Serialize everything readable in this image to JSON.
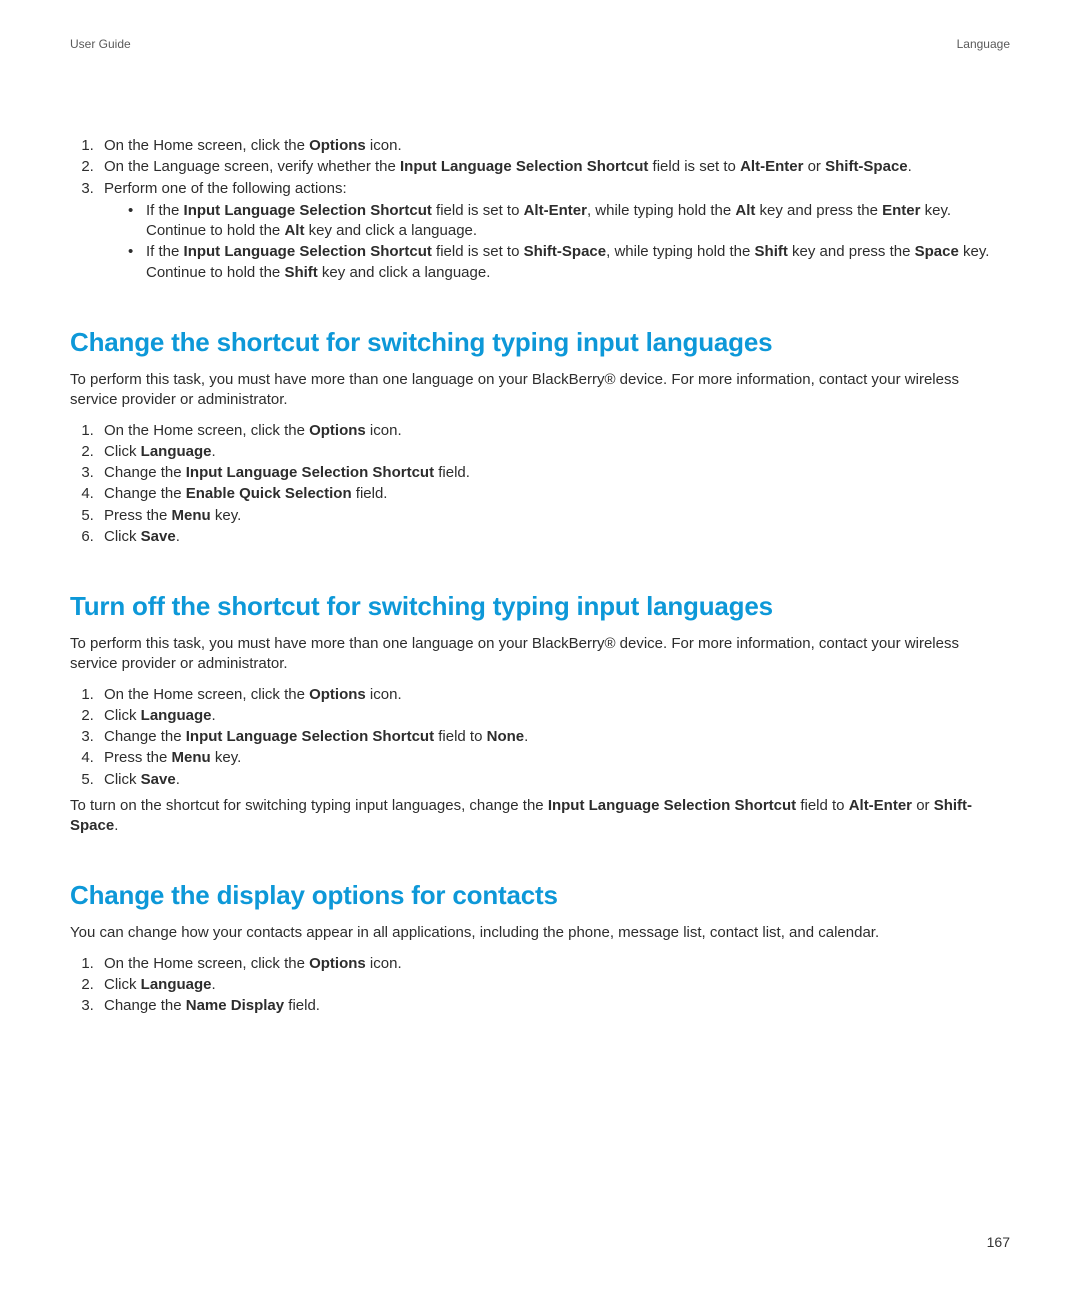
{
  "header": {
    "left": "User Guide",
    "right": "Language"
  },
  "intro": {
    "step1": {
      "t1": "On the Home screen, click the ",
      "b1": "Options",
      "t2": " icon."
    },
    "step2": {
      "t1": "On the Language screen, verify whether the ",
      "b1": "Input Language Selection Shortcut",
      "t2": " field is set to ",
      "b2": "Alt-Enter",
      "t3": " or ",
      "b3": "Shift-Space",
      "t4": "."
    },
    "step3": {
      "t1": "Perform one of the following actions:"
    },
    "sub1": {
      "t1": "If the ",
      "b1": "Input Language Selection Shortcut",
      "t2": " field is set to ",
      "b2": "Alt-Enter",
      "t3": ", while typing hold the ",
      "b3": "Alt",
      "t4": " key and press the ",
      "b4": "Enter",
      "t5": " key. Continue to hold the ",
      "b5": "Alt",
      "t6": " key and click a language."
    },
    "sub2": {
      "t1": "If the ",
      "b1": "Input Language Selection Shortcut",
      "t2": " field is set to ",
      "b2": "Shift-Space",
      "t3": ", while typing hold the ",
      "b3": "Shift",
      "t4": " key and press the ",
      "b4": "Space",
      "t5": " key. Continue to hold the ",
      "b5": "Shift",
      "t6": " key and click a language."
    }
  },
  "secA": {
    "title": "Change the shortcut for switching typing input languages",
    "desc": "To perform this task, you must have more than one language on your BlackBerry® device. For more information, contact your wireless service provider or administrator.",
    "s1": {
      "t1": "On the Home screen, click the ",
      "b1": "Options",
      "t2": " icon."
    },
    "s2": {
      "t1": "Click ",
      "b1": "Language",
      "t2": "."
    },
    "s3": {
      "t1": "Change the ",
      "b1": "Input Language Selection Shortcut",
      "t2": " field."
    },
    "s4": {
      "t1": "Change the ",
      "b1": "Enable Quick Selection",
      "t2": " field."
    },
    "s5": {
      "t1": "Press the ",
      "b1": "Menu",
      "t2": " key."
    },
    "s6": {
      "t1": "Click ",
      "b1": "Save",
      "t2": "."
    }
  },
  "secB": {
    "title": "Turn off the shortcut for switching typing input languages",
    "desc": "To perform this task, you must have more than one language on your BlackBerry® device. For more information, contact your wireless service provider or administrator.",
    "s1": {
      "t1": "On the Home screen, click the ",
      "b1": "Options",
      "t2": " icon."
    },
    "s2": {
      "t1": "Click ",
      "b1": "Language",
      "t2": "."
    },
    "s3": {
      "t1": "Change the ",
      "b1": "Input Language Selection Shortcut",
      "t2": " field to ",
      "b2": "None",
      "t3": "."
    },
    "s4": {
      "t1": "Press the ",
      "b1": "Menu",
      "t2": " key."
    },
    "s5": {
      "t1": "Click ",
      "b1": "Save",
      "t2": "."
    },
    "note": {
      "t1": "To turn on the shortcut for switching typing input languages, change the ",
      "b1": "Input Language Selection Shortcut",
      "t2": " field to ",
      "b2": "Alt-Enter",
      "t3": " or ",
      "b3": "Shift-Space",
      "t4": "."
    }
  },
  "secC": {
    "title": "Change the display options for contacts",
    "desc": "You can change how your contacts appear in all applications, including the phone, message list, contact list, and calendar.",
    "s1": {
      "t1": "On the Home screen, click the ",
      "b1": "Options",
      "t2": " icon."
    },
    "s2": {
      "t1": "Click ",
      "b1": "Language",
      "t2": "."
    },
    "s3": {
      "t1": "Change the ",
      "b1": "Name Display",
      "t2": " field."
    }
  },
  "page_number": "167"
}
